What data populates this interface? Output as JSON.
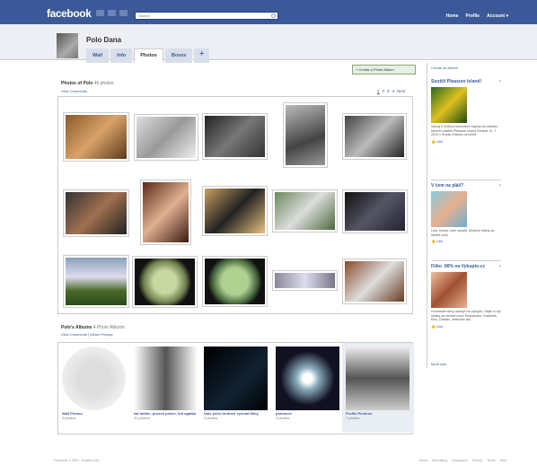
{
  "topbar": {
    "logo": "facebook",
    "search_placeholder": "Search",
    "nav": [
      "Home",
      "Profile",
      "Account ▾"
    ]
  },
  "profile": {
    "name": "Polo Dana",
    "tabs": [
      "Wall",
      "Info",
      "Photos",
      "Boxes"
    ],
    "active_tab": "Photos",
    "add_tab": "+"
  },
  "photos": {
    "create_album": "+ Create a Photo Album",
    "title": "Photos of Polo",
    "count": "46 photos",
    "view_comments": "View Comments",
    "pager": [
      "1",
      "2",
      "3",
      "4",
      "Next"
    ],
    "current_page": "1"
  },
  "albums": {
    "title": "Polo's Albums",
    "count": "4 Photo Albums",
    "links": "View Comments | Album Privacy",
    "items": [
      {
        "name": "Wall Photos",
        "count": "0 photos"
      },
      {
        "name": "tak takhle, prosím pekne, foti agatka",
        "count": "10 photos"
      },
      {
        "name": "Dalo jsem Ondrovi vyvolat filmy",
        "count": "4 photos"
      },
      {
        "name": "polotover",
        "count": "2 photos"
      },
      {
        "name": "Profile Pictures",
        "count": "7 photos"
      }
    ]
  },
  "ads": {
    "create_ad": "Create an Advert",
    "more_ads": "More Ads",
    "like": "Like",
    "items": [
      {
        "title": "Soutěž Pleasure Island!",
        "text": "Vyhraj s Vodkou Amundsen lupeny na unikátní taneční zážitek Pleasure Island Festival 14. 7. 2010 v Hradci Králové na letišti!"
      },
      {
        "title": "V čem na pláž?",
        "text": "Léto, slunce, letní nálada. Moderní bikiny za skvělé ceny."
      },
      {
        "title": "Fitko -90% na Vykupto.cz",
        "text": "Hromadné slevy sleduje na Vykupto. Užijte si top služby za zlomek ceny! Restaurace, Kadeřník, Kino, Divadlo, Wellness atd."
      }
    ]
  },
  "footer": {
    "left": "Facebook © 2010 · English (US)",
    "links": [
      "About",
      "Advertising",
      "Developers",
      "Privacy",
      "Terms",
      "Help"
    ]
  },
  "colors": {
    "brand": "#3b5998",
    "profile_bg": "#edeff4",
    "album_highlight": "#e9edf4"
  }
}
